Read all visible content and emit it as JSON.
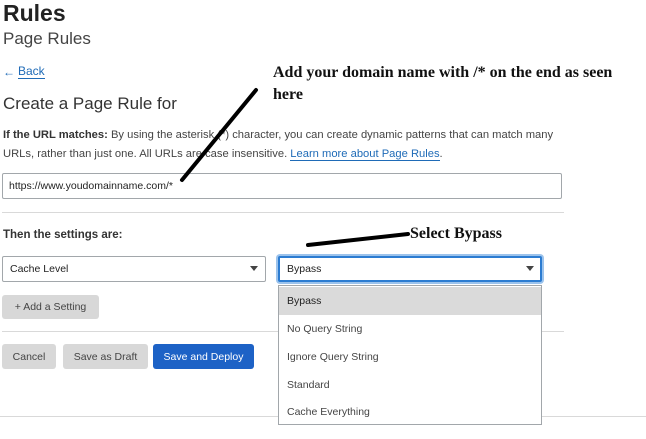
{
  "header": {
    "title": "Rules",
    "subtitle": "Page Rules"
  },
  "nav": {
    "back_label": "Back",
    "back_arrow": "←"
  },
  "form": {
    "heading": "Create a Page Rule for",
    "url_label": "If the URL matches:",
    "url_help": "By using the asterisk (*) character, you can create dynamic patterns that can match many URLs, rather than just one. All URLs are case insensitive.",
    "learn_more": "Learn more about Page Rules",
    "url_value": "https://www.youdomainname.com/*",
    "settings_label": "Then the settings are:",
    "setting_name": "Cache Level",
    "setting_value": "Bypass",
    "add_setting": "+ Add a Setting",
    "cancel": "Cancel",
    "save_draft": "Save as Draft",
    "save_deploy": "Save and Deploy"
  },
  "dropdown": {
    "options": [
      "Bypass",
      "No Query String",
      "Ignore Query String",
      "Standard",
      "Cache Everything"
    ],
    "selected": "Bypass"
  },
  "annotations": {
    "note1": "Add your domain name with /* on the end as seen here",
    "note2": "Select Bypass"
  },
  "colors": {
    "primary": "#1d62c6",
    "link": "#1f6bb7",
    "focus": "#2c7cd1"
  }
}
